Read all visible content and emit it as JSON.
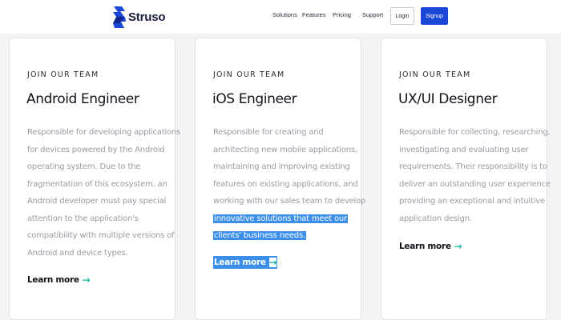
{
  "brand": {
    "name": "Struso"
  },
  "nav": {
    "links": [
      "Solutions",
      "Features",
      "Pricing",
      "Support"
    ],
    "login": "Login",
    "signup": "Signup"
  },
  "cards": [
    {
      "eyebrow": "JOIN OUR TEAM",
      "title": "Android Engineer",
      "lines": [
        "Responsible for developing applications",
        "for devices powered by the Android",
        "operating system. Due to the",
        "fragmentation of this ecosystem, an",
        "Android developer must pay special",
        "attention to the application's",
        "compatibility with multiple versions of",
        "Android and device types."
      ],
      "cta": "Learn more",
      "arrow": "→"
    },
    {
      "eyebrow": "JOIN OUR TEAM",
      "title": "iOS Engineer",
      "lines": [
        "Responsible for creating and",
        "architecting new mobile applications,",
        "maintaining and improving existing",
        "features on existing applications, and",
        "working with our sales team to develop"
      ],
      "selected_lines": [
        "innovative solutions that meet our",
        "clients' business needs."
      ],
      "cta": "Learn more",
      "arrow": "→"
    },
    {
      "eyebrow": "JOIN OUR TEAM",
      "title": "UX/UI Designer",
      "lines": [
        "Responsible for collecting, researching,",
        "investigating and evaluating user",
        "requirements. Their responsibility is to",
        "deliver an outstanding user experience",
        "providing an exceptional and intuitive",
        "application design."
      ],
      "cta": "Learn more",
      "arrow": "→"
    }
  ],
  "colors": {
    "primary": "#1a47d6",
    "accent_arrow": "#1fb8a6",
    "selection": "#3b8fe8"
  }
}
